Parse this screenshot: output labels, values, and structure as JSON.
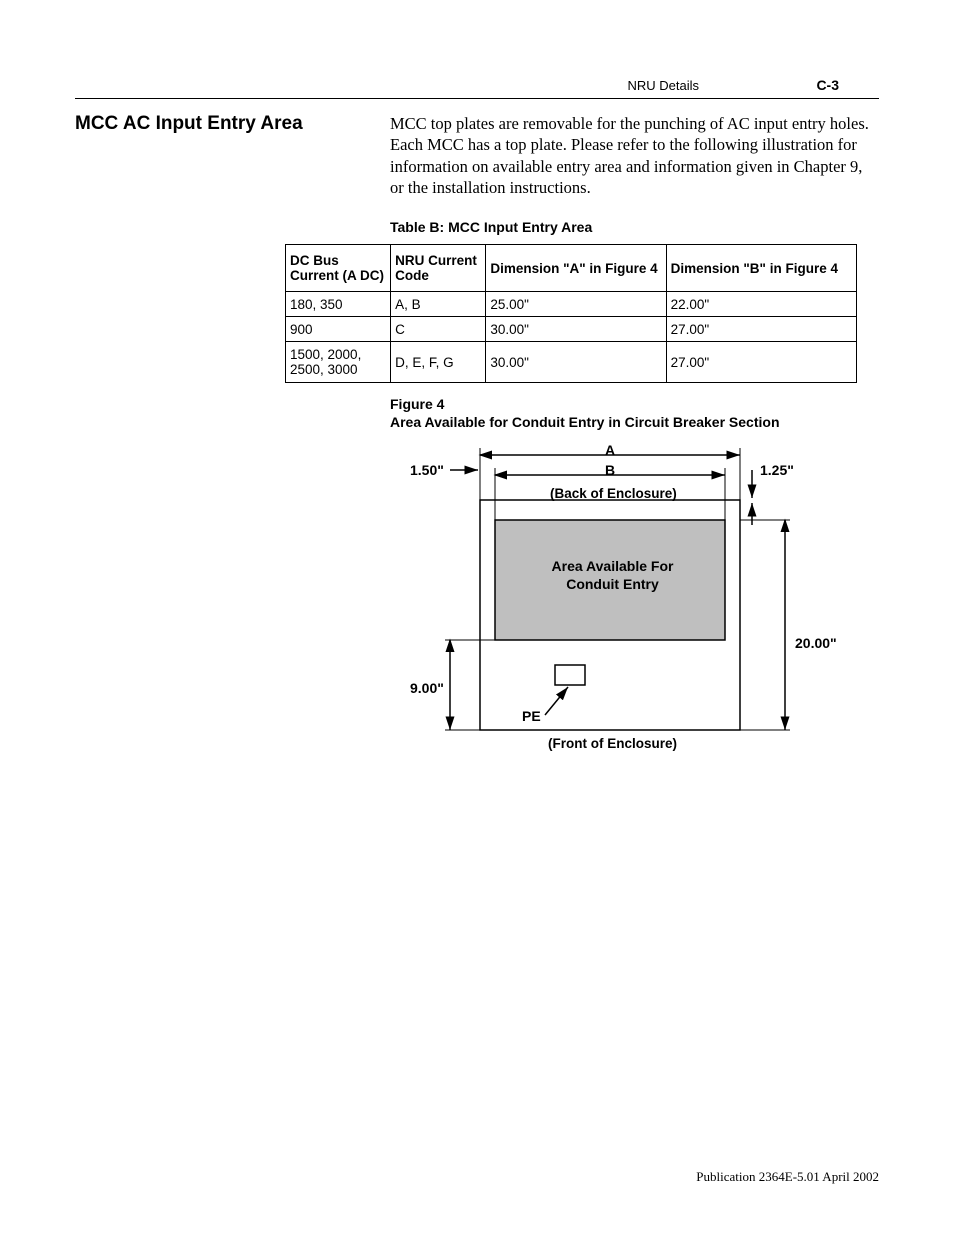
{
  "header": {
    "title": "NRU Details",
    "page": "C-3"
  },
  "section": {
    "heading": "MCC AC Input Entry Area",
    "paragraph": "MCC top plates are removable for the punching of AC input entry holes. Each MCC has a top plate. Please refer to the following illustration for information on available entry area and information given in Chapter 9, or the installation instructions."
  },
  "table": {
    "caption": "Table B: MCC Input Entry Area",
    "headers": [
      "DC Bus Current (A DC)",
      "NRU Current Code",
      "Dimension \"A\" in Figure 4",
      "Dimension \"B\" in Figure 4"
    ],
    "rows": [
      [
        "180, 350",
        "A, B",
        "25.00\"",
        "22.00\""
      ],
      [
        "900",
        "C",
        "30.00\"",
        "27.00\""
      ],
      [
        "1500, 2000, 2500, 3000",
        "D, E, F, G",
        "30.00\"",
        "27.00\""
      ]
    ]
  },
  "figure": {
    "caption_line1": "Figure 4",
    "caption_line2": "Area Available for Conduit Entry in Circuit Breaker Section",
    "labels": {
      "dim_left": "1.50\"",
      "dim_A": "A",
      "dim_B": "B",
      "dim_right_top": "1.25\"",
      "back": "(Back of Enclosure)",
      "area": "Area Available For Conduit Entry",
      "dim_right_side": "20.00\"",
      "dim_left_side": "9.00\"",
      "pe": "PE",
      "front": "(Front of Enclosure)"
    }
  },
  "footer": {
    "pub": "Publication 2364E-5.01 April 2002"
  },
  "chart_data": {
    "type": "table",
    "title": "MCC Input Entry Area",
    "columns": [
      "DC Bus Current (A DC)",
      "NRU Current Code",
      "Dimension A (in)",
      "Dimension B (in)"
    ],
    "rows": [
      {
        "dc_bus_current": "180, 350",
        "nru_code": "A, B",
        "dim_A_in": 25.0,
        "dim_B_in": 22.0
      },
      {
        "dc_bus_current": "900",
        "nru_code": "C",
        "dim_A_in": 30.0,
        "dim_B_in": 27.0
      },
      {
        "dc_bus_current": "1500, 2000, 2500, 3000",
        "nru_code": "D, E, F, G",
        "dim_A_in": 30.0,
        "dim_B_in": 27.0
      }
    ],
    "figure4_fixed_dims_in": {
      "left_margin": 1.5,
      "right_top_margin": 1.25,
      "front_offset": 9.0,
      "total_depth": 20.0
    }
  }
}
